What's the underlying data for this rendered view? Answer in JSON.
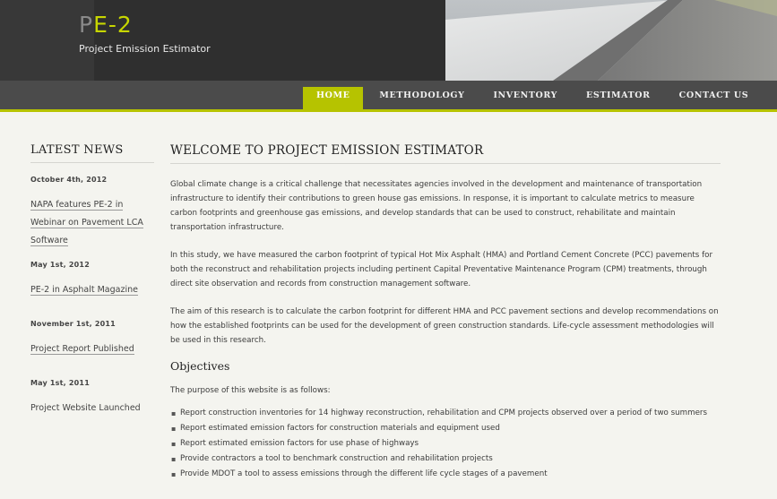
{
  "header": {
    "logo_p": "P",
    "logo_rest": "E-2",
    "subtitle": "Project Emission Estimator"
  },
  "nav": {
    "items": [
      "HOME",
      "METHODOLOGY",
      "INVENTORY",
      "ESTIMATOR",
      "CONTACT US"
    ],
    "active": "HOME"
  },
  "sidebar": {
    "title": "LATEST NEWS",
    "news": [
      {
        "date": "October 4th, 2012",
        "link": "NAPA features PE-2 in Webinar on Pavement LCA Software"
      },
      {
        "date": "May 1st, 2012",
        "link": "PE-2 in Asphalt Magazine"
      },
      {
        "date": "November 1st, 2011",
        "link": "Project Report Published"
      },
      {
        "date": "May 1st, 2011",
        "link": "Project Website Launched"
      }
    ]
  },
  "main": {
    "title": "WELCOME TO PROJECT EMISSION ESTIMATOR",
    "p1": "Global climate change is a critical challenge that necessitates agencies involved in the development and maintenance of transportation infrastructure to identify their contributions to green house gas emissions. In response, it is important to calculate metrics to measure carbon footprints and greenhouse gas emissions, and develop standards that can be used to construct, rehabilitate and maintain transportation infrastructure.",
    "p2": "In this study, we have measured the carbon footprint of typical Hot Mix Asphalt (HMA) and Portland Cement Concrete (PCC) pavements for both the reconstruct and rehabilitation projects including pertinent Capital Preventative Maintenance Program (CPM) treatments, through direct site observation and records from construction management software.",
    "p3": "The aim of this research is to calculate the carbon footprint for different HMA and PCC pavement sections and develop recommendations on how the established footprints can be used for the development of green construction standards. Life-cycle assessment methodologies will be used in this research.",
    "objectives_title": "Objectives",
    "objectives_intro": "The purpose of this website is as follows:",
    "bullets": [
      "Report construction inventories for 14 highway reconstruction, rehabilitation and CPM projects observed over a period of two summers",
      "Report estimated emission factors for construction materials and equipment used",
      "Report estimated emission factors for use phase of highways",
      "Provide contractors a tool to benchmark construction and rehabilitation projects",
      "Provide MDOT a tool to assess emissions through the different life cycle stages of a pavement"
    ]
  },
  "colors": {
    "accent": "#b6c300",
    "header_bg": "#2f2f2f",
    "nav_bg": "#4b4b4b",
    "page_bg": "#f4f4ef"
  }
}
